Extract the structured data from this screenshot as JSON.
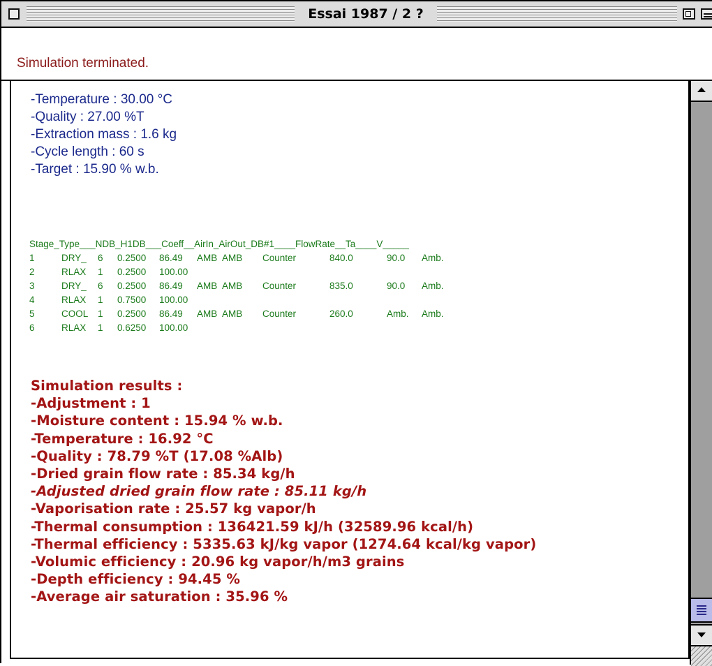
{
  "window": {
    "title": "Essai 1987 / 2 ?"
  },
  "status": {
    "message": "Simulation terminated."
  },
  "parameters": [
    "-Temperature :  30.00 °C",
    "-Quality : 27.00 %T",
    "-Extraction mass : 1.6 kg",
    "-Cycle length :  60 s",
    "-Target : 15.90 % w.b."
  ],
  "stage_table": {
    "header": "Stage_Type___NDB_H1DB___Coeff__AirIn_AirOut_DB#1____FlowRate__Ta____V_____",
    "rows": [
      [
        "1",
        "DRY_",
        "6",
        "0.2500",
        "86.49",
        "AMB",
        "AMB",
        "Counter",
        "840.0",
        "90.0",
        "Amb."
      ],
      [
        "2",
        "RLAX",
        "1",
        "0.2500",
        "100.00",
        "",
        "",
        "",
        "",
        "",
        ""
      ],
      [
        "3",
        "DRY_",
        "6",
        "0.2500",
        "86.49",
        "AMB",
        "AMB",
        "Counter",
        "835.0",
        "90.0",
        "Amb."
      ],
      [
        "4",
        "RLAX",
        "1",
        "0.7500",
        "100.00",
        "",
        "",
        "",
        "",
        "",
        ""
      ],
      [
        "5",
        "COOL",
        "1",
        "0.2500",
        "86.49",
        "AMB",
        "AMB",
        "Counter",
        "260.0",
        "Amb.",
        "Amb."
      ],
      [
        "6",
        "RLAX",
        "1",
        "0.6250",
        "100.00",
        "",
        "",
        "",
        "",
        "",
        ""
      ]
    ]
  },
  "results": {
    "title": "Simulation results :",
    "lines": [
      "-Adjustment : 1",
      "-Moisture content : 15.94 % w.b.",
      "-Temperature : 16.92 °C",
      "-Quality : 78.79 %T (17.08 %Alb)",
      "-Dried grain flow rate : 85.34 kg/h",
      "-Adjusted dried grain flow rate : 85.11 kg/h",
      "-Vaporisation rate : 25.57 kg vapor/h",
      "-Thermal consumption : 136421.59 kJ/h (32589.96 kcal/h)",
      "-Thermal efficiency : 5335.63 kJ/kg vapor (1274.64 kcal/kg vapor)",
      "-Volumic efficiency : 20.96 kg vapor/h/m3 grains",
      "-Depth efficiency : 94.45 %",
      "-Average air saturation : 35.96 %"
    ]
  },
  "colors": {
    "status_text": "#8b1a1a",
    "parameters_text": "#1c2a8c",
    "table_text": "#1a7a1a",
    "results_text": "#a31515",
    "scroll_thumb": "#b9bbe8"
  },
  "icons": {
    "close_box": "close-box-icon",
    "zoom_box": "zoom-box-icon",
    "collapse_box": "collapse-box-icon",
    "scroll_up": "arrow-up-icon",
    "scroll_down": "arrow-down-icon",
    "grow_box": "resize-grip-icon"
  }
}
